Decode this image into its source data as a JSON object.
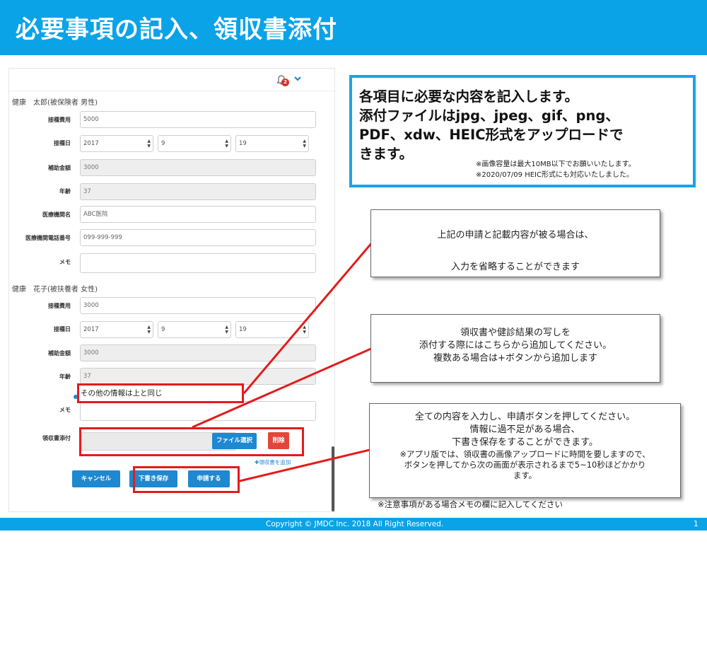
{
  "header": {
    "title": "必要事項の記入、領収書添付"
  },
  "topbar": {
    "notification_count": "2"
  },
  "persons": [
    {
      "heading": "健康　太郎(被保険者 男性)",
      "fields": {
        "fee_label": "接種費用",
        "fee_value": "5000",
        "date_label": "接種日",
        "year": "2017",
        "month": "9",
        "day": "19",
        "subsidy_label": "補助金額",
        "subsidy_value": "3000",
        "age_label": "年齢",
        "age_value": "37",
        "clinic_label": "医療機関名",
        "clinic_value": "ABC医院",
        "phone_label": "医療機関電話番号",
        "phone_value": "099-999-999",
        "memo_label": "メモ"
      }
    },
    {
      "heading": "健康　花子(被扶養者 女性)",
      "fields": {
        "fee_label": "接種費用",
        "fee_value": "3000",
        "date_label": "接種日",
        "year": "2017",
        "month": "9",
        "day": "19",
        "subsidy_label": "補助金額",
        "subsidy_value": "3000",
        "age_label": "年齢",
        "age_value": "37",
        "other_info_label": "その他の情報は上と同じ",
        "memo_label": "メモ"
      }
    }
  ],
  "receipt": {
    "label": "領収書添付",
    "file_button": "ファイル選択",
    "delete_button": "削除",
    "add_link": "✚領収書を追加"
  },
  "actions": {
    "cancel": "キャンセル",
    "draft": "下書き保存",
    "submit": "申請する"
  },
  "info_box": {
    "line1": "各項目に必要な内容を記入します。",
    "line2": "添付ファイルはjpg、jpeg、gif、png、",
    "line3": "PDF、xdw、HEIC形式をアップロードで",
    "line4": "きます。",
    "note1": "※画像容量は最大10MB以下でお願いいたします。",
    "note2": "※2020/07/09 HEIC形式にも対応いたしました。"
  },
  "callouts": {
    "same_info": [
      "上記の申請と記載内容が被る場合は、",
      "入力を省略することができます"
    ],
    "receipt": [
      "領収書や健診結果の写しを",
      "添付する際にはこちらから追加してください。",
      "複数ある場合は+ボタンから追加します"
    ],
    "submit": [
      "全ての内容を入力し、申請ボタンを押してください。",
      "情報に過不足がある場合、",
      "下書き保存をすることができます。"
    ],
    "submit_small": [
      "※アプリ版では、領収書の画像アップロードに時間を要しますので、",
      "ボタンを押してから次の画面が表示されるまで5~10秒ほどかかり",
      "ます。"
    ]
  },
  "footnote": "※注意事項がある場合メモの欄に記入してください",
  "footer": {
    "copyright": "Copyright © JMDC Inc. 2018 All Right Reserved.",
    "page": "1"
  },
  "colors": {
    "brand": "#0aa3e8",
    "button": "#1e88d0",
    "danger": "#e0473a",
    "highlight": "#e31c1c"
  }
}
